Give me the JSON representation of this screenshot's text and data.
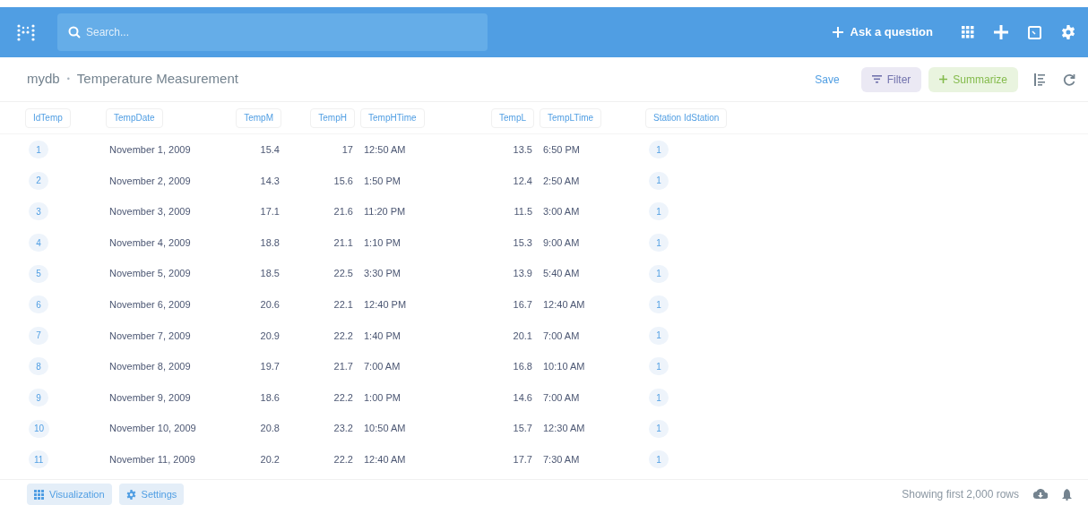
{
  "header": {
    "search_placeholder": "Search...",
    "ask_label": "Ask a question"
  },
  "breadcrumb": {
    "database": "mydb",
    "separator": "•",
    "table": "Temperature Measurement"
  },
  "actions": {
    "save": "Save",
    "filter": "Filter",
    "summarize": "Summarize"
  },
  "table": {
    "columns": [
      {
        "label": "IdTemp",
        "kind": "id"
      },
      {
        "label": "TempDate",
        "kind": "text"
      },
      {
        "label": "TempM",
        "kind": "number"
      },
      {
        "label": "TempH",
        "kind": "number"
      },
      {
        "label": "TempHTime",
        "kind": "text"
      },
      {
        "label": "TempL",
        "kind": "number"
      },
      {
        "label": "TempLTime",
        "kind": "text"
      },
      {
        "label": "Station IdStation",
        "kind": "id"
      }
    ],
    "rows": [
      [
        "1",
        "November 1, 2009",
        "15.4",
        "17",
        "12:50 AM",
        "13.5",
        "6:50 PM",
        "1"
      ],
      [
        "2",
        "November 2, 2009",
        "14.3",
        "15.6",
        "1:50 PM",
        "12.4",
        "2:50 AM",
        "1"
      ],
      [
        "3",
        "November 3, 2009",
        "17.1",
        "21.6",
        "11:20 PM",
        "11.5",
        "3:00 AM",
        "1"
      ],
      [
        "4",
        "November 4, 2009",
        "18.8",
        "21.1",
        "1:10 PM",
        "15.3",
        "9:00 AM",
        "1"
      ],
      [
        "5",
        "November 5, 2009",
        "18.5",
        "22.5",
        "3:30 PM",
        "13.9",
        "5:40 AM",
        "1"
      ],
      [
        "6",
        "November 6, 2009",
        "20.6",
        "22.1",
        "12:40 PM",
        "16.7",
        "12:40 AM",
        "1"
      ],
      [
        "7",
        "November 7, 2009",
        "20.9",
        "22.2",
        "1:40 PM",
        "20.1",
        "7:00 AM",
        "1"
      ],
      [
        "8",
        "November 8, 2009",
        "19.7",
        "21.7",
        "7:00 AM",
        "16.8",
        "10:10 AM",
        "1"
      ],
      [
        "9",
        "November 9, 2009",
        "18.6",
        "22.2",
        "1:00 PM",
        "14.6",
        "7:00 AM",
        "1"
      ],
      [
        "10",
        "November 10, 2009",
        "20.8",
        "23.2",
        "10:50 AM",
        "15.7",
        "12:30 AM",
        "1"
      ],
      [
        "11",
        "November 11, 2009",
        "20.2",
        "22.2",
        "12:40 AM",
        "17.7",
        "7:30 AM",
        "1"
      ]
    ]
  },
  "footer": {
    "visualization": "Visualization",
    "settings": "Settings",
    "row_count": "Showing first 2,000 rows"
  }
}
